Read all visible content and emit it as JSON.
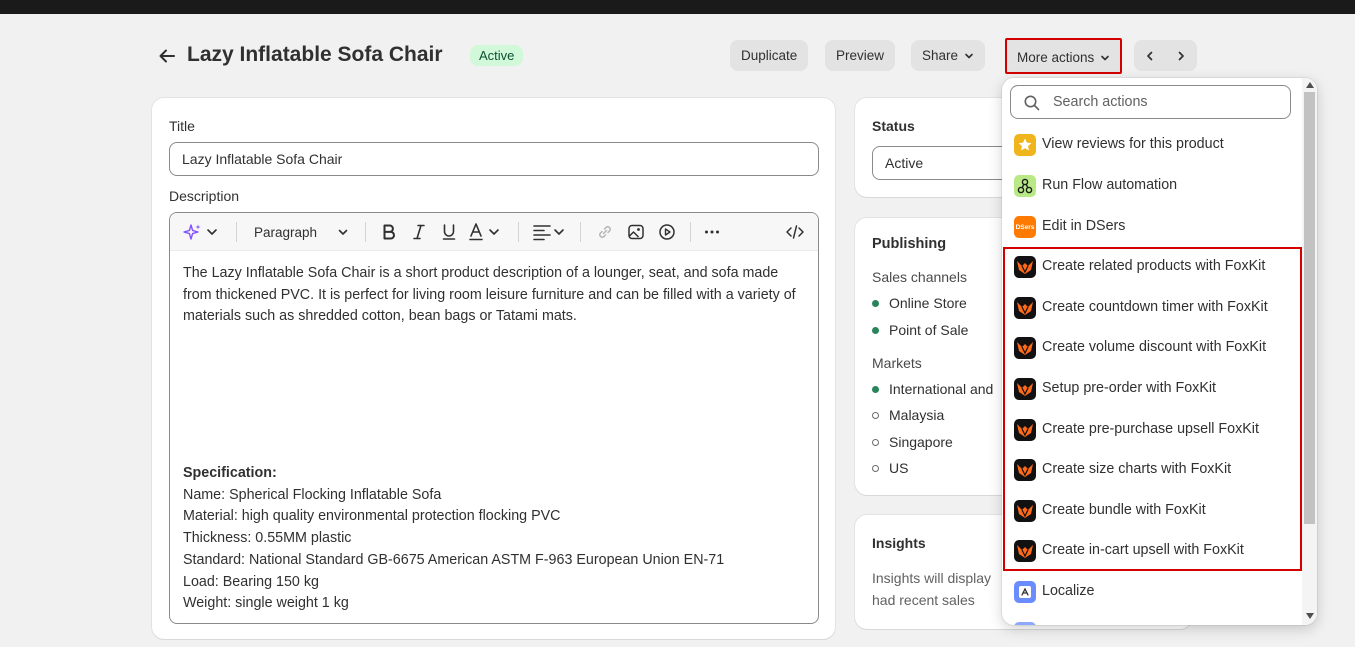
{
  "header": {
    "title": "Lazy Inflatable Sofa Chair",
    "status_badge": "Active",
    "buttons": {
      "duplicate": "Duplicate",
      "preview": "Preview",
      "share": "Share",
      "more_actions": "More actions"
    }
  },
  "product": {
    "title_label": "Title",
    "title_value": "Lazy Inflatable Sofa Chair",
    "description_label": "Description",
    "toolbar": {
      "paragraph": "Paragraph"
    },
    "description": "The Lazy Inflatable Sofa Chair is a short product description of a lounger, seat, and sofa made from thickened PVC. It is perfect for living room leisure furniture and can be filled with a variety of materials such as shredded cotton, bean bags or Tatami mats.",
    "spec_heading": "Specification:",
    "spec_lines": [
      "Name: Spherical Flocking Inflatable Sofa",
      "Material: high quality environmental protection flocking PVC",
      "Thickness: 0.55MM plastic",
      "Standard: National Standard GB-6675 American ASTM F-963 European Union EN-71",
      "Load: Bearing 150 kg",
      "Weight: single weight 1 kg"
    ]
  },
  "status": {
    "label": "Status",
    "value": "Active"
  },
  "publishing": {
    "label": "Publishing",
    "sales_channels_label": "Sales channels",
    "channels": [
      "Online Store",
      "Point of Sale"
    ],
    "markets_label": "Markets",
    "markets": [
      "International and",
      "Malaysia",
      "Singapore",
      "US"
    ]
  },
  "insights": {
    "label": "Insights",
    "text_1": "Insights will display",
    "text_2": "had recent sales"
  },
  "actions_menu": {
    "search_placeholder": "Search actions",
    "items": [
      "View reviews for this product",
      "Run Flow automation",
      "Edit in DSers",
      "Create related products with FoxKit",
      "Create countdown timer with FoxKit",
      "Create volume discount with FoxKit",
      "Setup pre-order with FoxKit",
      "Create pre-purchase upsell FoxKit",
      "Create size charts with FoxKit",
      "Create bundle with FoxKit",
      "Create in-cart upsell with FoxKit",
      "Localize"
    ],
    "dsers_icon_text": "DSers"
  },
  "colors": {
    "highlight": "#d40000",
    "active_badge_bg": "#d1f8d9",
    "active_badge_text": "#0c5132",
    "channel_on": "#29845a"
  }
}
